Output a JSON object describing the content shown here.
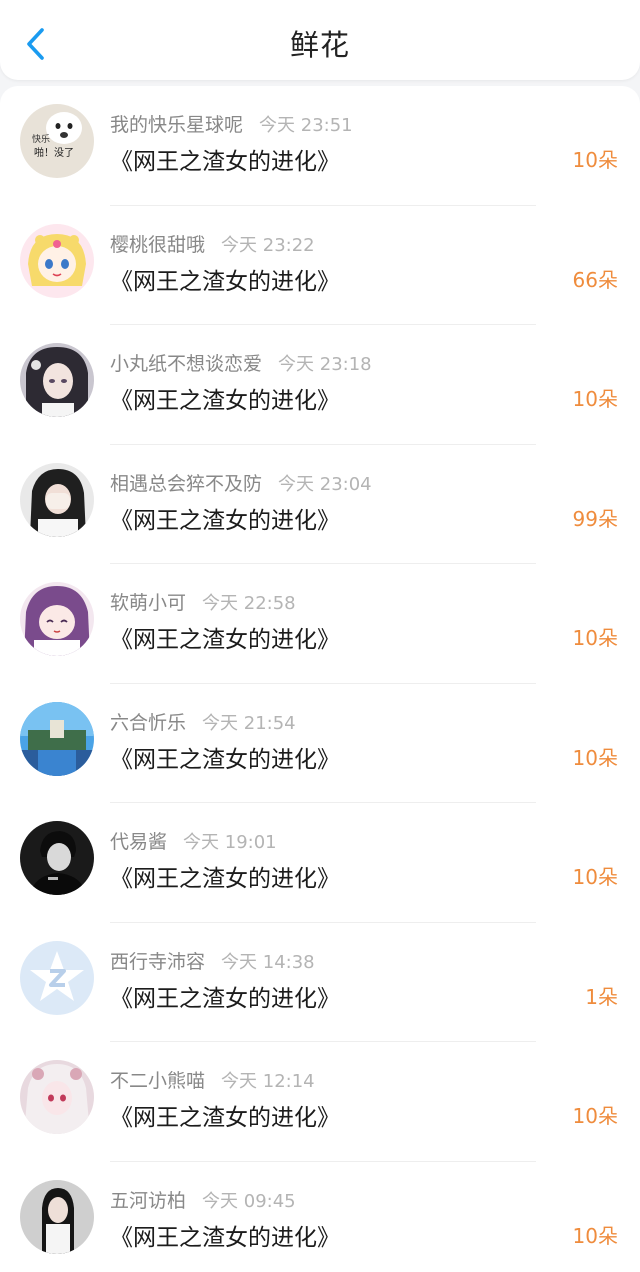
{
  "header": {
    "title": "鲜花"
  },
  "colors": {
    "accent": "#1a9bf0",
    "count": "#ef8c3d"
  },
  "rows": [
    {
      "name": "我的快乐星球呢",
      "time": "今天 23:51",
      "book": "《网王之渣女的进化》",
      "count": "10朵",
      "avatar_text": [
        "快乐",
        "啪！没了"
      ]
    },
    {
      "name": "樱桃很甜哦",
      "time": "今天 23:22",
      "book": "《网王之渣女的进化》",
      "count": "66朵"
    },
    {
      "name": "小丸纸不想谈恋爱",
      "time": "今天 23:18",
      "book": "《网王之渣女的进化》",
      "count": "10朵"
    },
    {
      "name": "相遇总会猝不及防",
      "time": "今天 23:04",
      "book": "《网王之渣女的进化》",
      "count": "99朵"
    },
    {
      "name": "软萌小可",
      "time": "今天 22:58",
      "book": "《网王之渣女的进化》",
      "count": "10朵"
    },
    {
      "name": "六合忻乐",
      "time": "今天 21:54",
      "book": "《网王之渣女的进化》",
      "count": "10朵"
    },
    {
      "name": "代易酱",
      "time": "今天 19:01",
      "book": "《网王之渣女的进化》",
      "count": "10朵"
    },
    {
      "name": "西行寺沛容",
      "time": "今天 14:38",
      "book": "《网王之渣女的进化》",
      "count": "1朵"
    },
    {
      "name": "不二小熊喵",
      "time": "今天 12:14",
      "book": "《网王之渣女的进化》",
      "count": "10朵"
    },
    {
      "name": "五河访柏",
      "time": "今天 09:45",
      "book": "《网王之渣女的进化》",
      "count": "10朵"
    }
  ]
}
